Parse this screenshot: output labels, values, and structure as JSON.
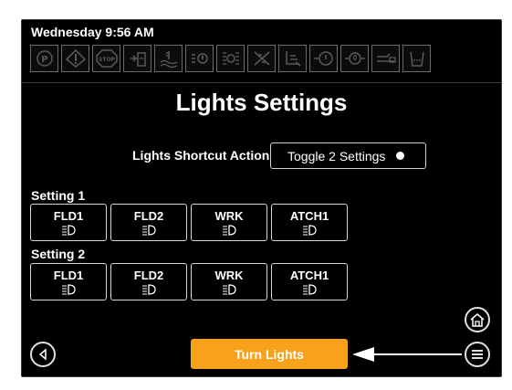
{
  "status": {
    "clock": "Wednesday 9:56 AM"
  },
  "indicators": [
    "parking-brake-icon",
    "warning-icon",
    "stop-icon",
    "fuel-icon",
    "coolant-icon",
    "left-turn-icon",
    "hazard-icon",
    "cross-icon",
    "exhaust-icon",
    "brake-icon",
    "oil-icon",
    "battery-icon",
    "tank-icon"
  ],
  "page": {
    "title": "Lights Settings"
  },
  "shortcut": {
    "label": "Lights Shortcut Action",
    "value": "Toggle 2 Settings"
  },
  "settings": [
    {
      "label": "Setting 1",
      "buttons": [
        "FLD1",
        "FLD2",
        "WRK",
        "ATCH1"
      ]
    },
    {
      "label": "Setting 2",
      "buttons": [
        "FLD1",
        "FLD2",
        "WRK",
        "ATCH1"
      ]
    }
  ],
  "footer": {
    "turn_lights_label": "Turn Lights"
  },
  "colors": {
    "accent": "#f7a21a",
    "background": "#000000"
  }
}
